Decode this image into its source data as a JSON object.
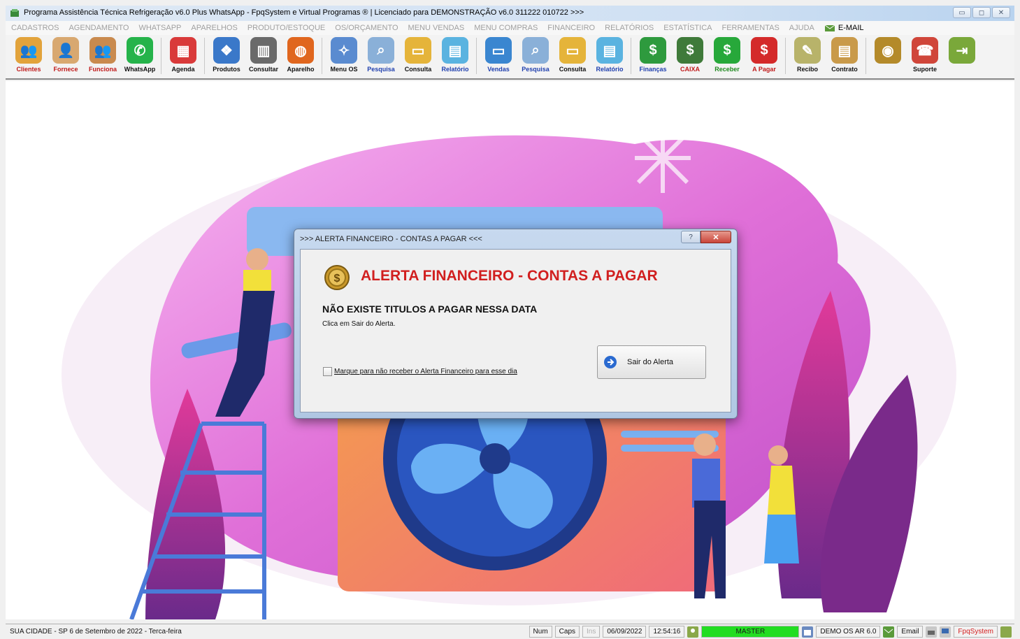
{
  "window": {
    "title": "Programa Assistência Técnica Refrigeração v6.0 Plus WhatsApp - FpqSystem e Virtual Programas ® | Licenciado para  DEMONSTRAÇÃO v6.0 311222 010722 >>>",
    "minimize": "▭",
    "maximize": "◻",
    "close": "✕"
  },
  "menu": {
    "items": [
      "CADASTROS",
      "AGENDAMENTO",
      "WHATSAPP",
      "APARELHOS",
      "PRODUTO/ESTOQUE",
      "OS/ORÇAMENTO",
      "MENU VENDAS",
      "MENU COMPRAS",
      "FINANCEIRO",
      "RELATÓRIOS",
      "ESTATÍSTICA",
      "FERRAMENTAS",
      "AJUDA"
    ],
    "email": "E-MAIL"
  },
  "toolbar": {
    "buttons": [
      {
        "label": "Clientes",
        "icon": "people-icon",
        "color": "#e2a33b",
        "glyph": "👥",
        "style": "red"
      },
      {
        "label": "Fornece",
        "icon": "supplier-icon",
        "color": "#d8a870",
        "glyph": "👤",
        "style": "red"
      },
      {
        "label": "Funciona",
        "icon": "employees-icon",
        "color": "#c98a4e",
        "glyph": "👥",
        "style": "red"
      },
      {
        "label": "WhatsApp",
        "icon": "whatsapp-icon",
        "color": "#25b34a",
        "glyph": "✆",
        "style": ""
      },
      {
        "label": "Agenda",
        "icon": "calendar-icon",
        "color": "#d93a3a",
        "glyph": "▦",
        "style": ""
      },
      {
        "label": "Produtos",
        "icon": "products-icon",
        "color": "#3a78c9",
        "glyph": "❖",
        "style": ""
      },
      {
        "label": "Consultar",
        "icon": "barcode-icon",
        "color": "#6a6a6a",
        "glyph": "▥",
        "style": ""
      },
      {
        "label": "Aparelho",
        "icon": "appliance-icon",
        "color": "#e0661e",
        "glyph": "◍",
        "style": ""
      },
      {
        "label": "Menu OS",
        "icon": "tools-icon",
        "color": "#5a8bd0",
        "glyph": "✧",
        "style": ""
      },
      {
        "label": "Pesquisa",
        "icon": "search-doc-icon",
        "color": "#8ab0d8",
        "glyph": "⌕",
        "style": "blue"
      },
      {
        "label": "Consulta",
        "icon": "folder-icon",
        "color": "#e5b43a",
        "glyph": "▭",
        "style": ""
      },
      {
        "label": "Relatório",
        "icon": "report-icon",
        "color": "#5ab3e0",
        "glyph": "▤",
        "style": "blue"
      },
      {
        "label": "Vendas",
        "icon": "monitor-icon",
        "color": "#3a86d0",
        "glyph": "▭",
        "style": "blue"
      },
      {
        "label": "Pesquisa",
        "icon": "search-doc-icon",
        "color": "#8ab0d8",
        "glyph": "⌕",
        "style": "blue"
      },
      {
        "label": "Consulta",
        "icon": "folder-icon",
        "color": "#e5b43a",
        "glyph": "▭",
        "style": ""
      },
      {
        "label": "Relatório",
        "icon": "report-icon",
        "color": "#5ab3e0",
        "glyph": "▤",
        "style": "blue"
      },
      {
        "label": "Finanças",
        "icon": "finance-icon",
        "color": "#2e9a3e",
        "glyph": "$",
        "style": "blue"
      },
      {
        "label": "CAIXA",
        "icon": "cashier-icon",
        "color": "#3f7a3a",
        "glyph": "$",
        "style": "red"
      },
      {
        "label": "Receber",
        "icon": "receive-money-icon",
        "color": "#27a83a",
        "glyph": "$",
        "style": "green"
      },
      {
        "label": "A Pagar",
        "icon": "pay-money-icon",
        "color": "#d42a2a",
        "glyph": "$",
        "style": "red"
      },
      {
        "label": "Recibo",
        "icon": "receipt-icon",
        "color": "#b8b36a",
        "glyph": "✎",
        "style": ""
      },
      {
        "label": "Contrato",
        "icon": "contract-icon",
        "color": "#c99a4a",
        "glyph": "▤",
        "style": ""
      },
      {
        "label": "",
        "icon": "coins-icon",
        "color": "#b48a2a",
        "glyph": "◉",
        "style": ""
      },
      {
        "label": "Suporte",
        "icon": "support-icon",
        "color": "#d0463a",
        "glyph": "☎",
        "style": ""
      },
      {
        "label": "",
        "icon": "exit-door-icon",
        "color": "#7aa83a",
        "glyph": "⇥",
        "style": ""
      }
    ]
  },
  "dialog": {
    "title": ">>> ALERTA FINANCEIRO - CONTAS A PAGAR <<<",
    "help": "?",
    "close": "✕",
    "heading": "ALERTA FINANCEIRO - CONTAS A PAGAR",
    "message": "NÃO EXISTE TITULOS A PAGAR NESSA DATA",
    "sub_message": "Clica em Sair do Alerta.",
    "checkbox_label": "Marque para não receber o Alerta Financeiro para esse dia",
    "exit_button": "Sair do Alerta"
  },
  "status": {
    "location_date": "SUA CIDADE - SP  6 de Setembro de 2022 - Terca-feira",
    "num": "Num",
    "caps": "Caps",
    "ins": "Ins",
    "date": "06/09/2022",
    "time": "12:54:16",
    "user": "MASTER",
    "company": "DEMO OS AR 6.0",
    "email": "Email",
    "brand": "FpqSystem"
  }
}
